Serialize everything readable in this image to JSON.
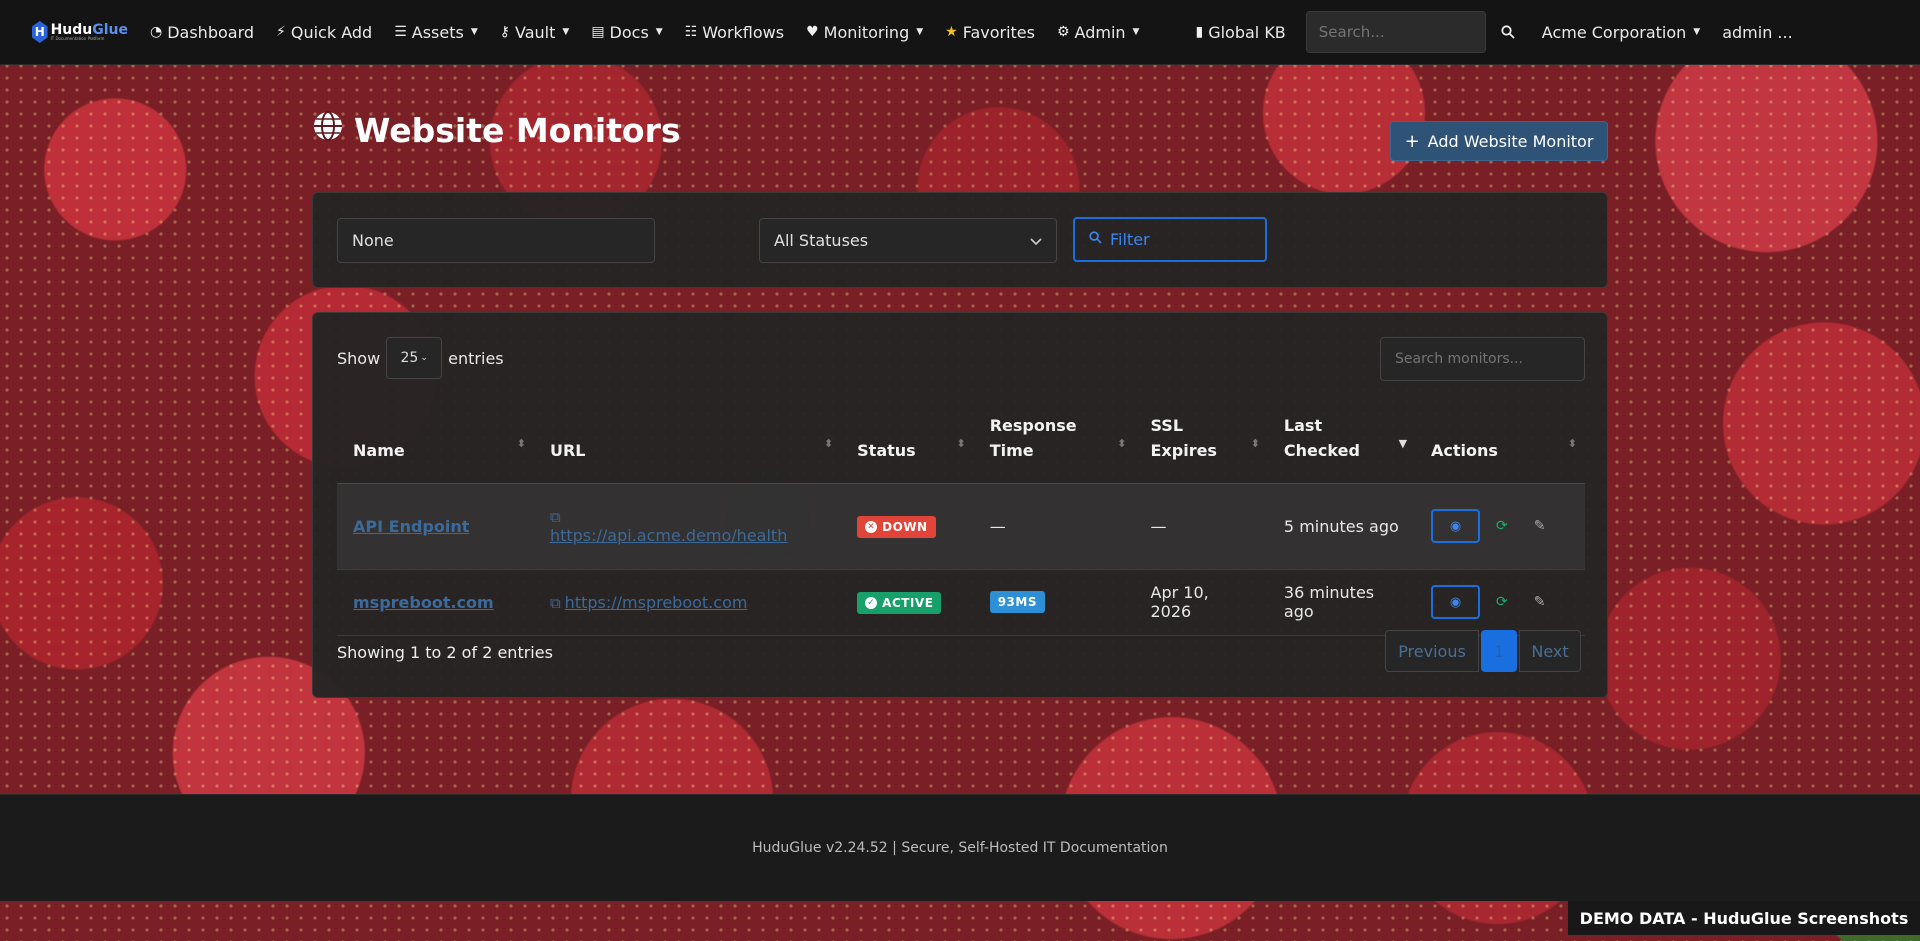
{
  "brand": {
    "name_a": "Hudu",
    "name_b": "Glue",
    "tagline": "IT Documentation Platform"
  },
  "nav": {
    "items": [
      {
        "label": "Dashboard",
        "icon": "tachometer-icon",
        "glyph": "◔",
        "caret": false
      },
      {
        "label": "Quick Add",
        "icon": "bolt-icon",
        "glyph": "⚡",
        "caret": false
      },
      {
        "label": "Assets",
        "icon": "database-icon",
        "glyph": "☰",
        "caret": true
      },
      {
        "label": "Vault",
        "icon": "key-icon",
        "glyph": "⚷",
        "caret": true
      },
      {
        "label": "Docs",
        "icon": "file-icon",
        "glyph": "▤",
        "caret": true
      },
      {
        "label": "Workflows",
        "icon": "checklist-icon",
        "glyph": "☷",
        "caret": false
      },
      {
        "label": "Monitoring",
        "icon": "heartbeat-icon",
        "glyph": "♥",
        "caret": true
      },
      {
        "label": "Favorites",
        "icon": "star-icon",
        "glyph": "★",
        "caret": false
      },
      {
        "label": "Admin",
        "icon": "gear-icon",
        "glyph": "⚙",
        "caret": true
      }
    ],
    "global_kb": "Global KB",
    "search_placeholder": "Search...",
    "company": "Acme Corporation",
    "user": "admin ..."
  },
  "page": {
    "title": "Website Monitors",
    "add_button": "Add Website Monitor"
  },
  "filters": {
    "company_value": "None",
    "status_value": "All Statuses",
    "filter_button": "Filter"
  },
  "table": {
    "show_label": "Show",
    "entries_label": "entries",
    "page_length": "25",
    "search_placeholder": "Search monitors...",
    "columns": [
      "Name",
      "URL",
      "Status",
      "Response Time",
      "SSL Expires",
      "Last Checked",
      "Actions"
    ],
    "column_lines": [
      [
        "Name"
      ],
      [
        "URL"
      ],
      [
        "Status"
      ],
      [
        "Response",
        "Time"
      ],
      [
        "SSL",
        "Expires"
      ],
      [
        "Last",
        "Checked"
      ],
      [
        "Actions"
      ]
    ],
    "rows": [
      {
        "name": "API Endpoint",
        "url": "https://api.acme.demo/health",
        "status": "DOWN",
        "response": "—",
        "ssl": "—",
        "checked": "5 minutes ago"
      },
      {
        "name": "mspreboot.com",
        "url": "https://mspreboot.com",
        "status": "ACTIVE",
        "response": "93MS",
        "ssl": "Apr 10, 2026",
        "checked": "36 minutes ago"
      }
    ],
    "info": "Showing 1 to 2 of 2 entries",
    "pager": {
      "prev": "Previous",
      "current": "1",
      "next": "Next"
    }
  },
  "footer": {
    "text": "HuduGlue v2.24.52 | Secure, Self-Hosted IT Documentation"
  },
  "demo_banner": "DEMO DATA - HuduGlue Screenshots",
  "colors": {
    "accent": "#1a6fe0",
    "down": "#e1453a",
    "active": "#17a06a",
    "response": "#2d8fd6"
  }
}
